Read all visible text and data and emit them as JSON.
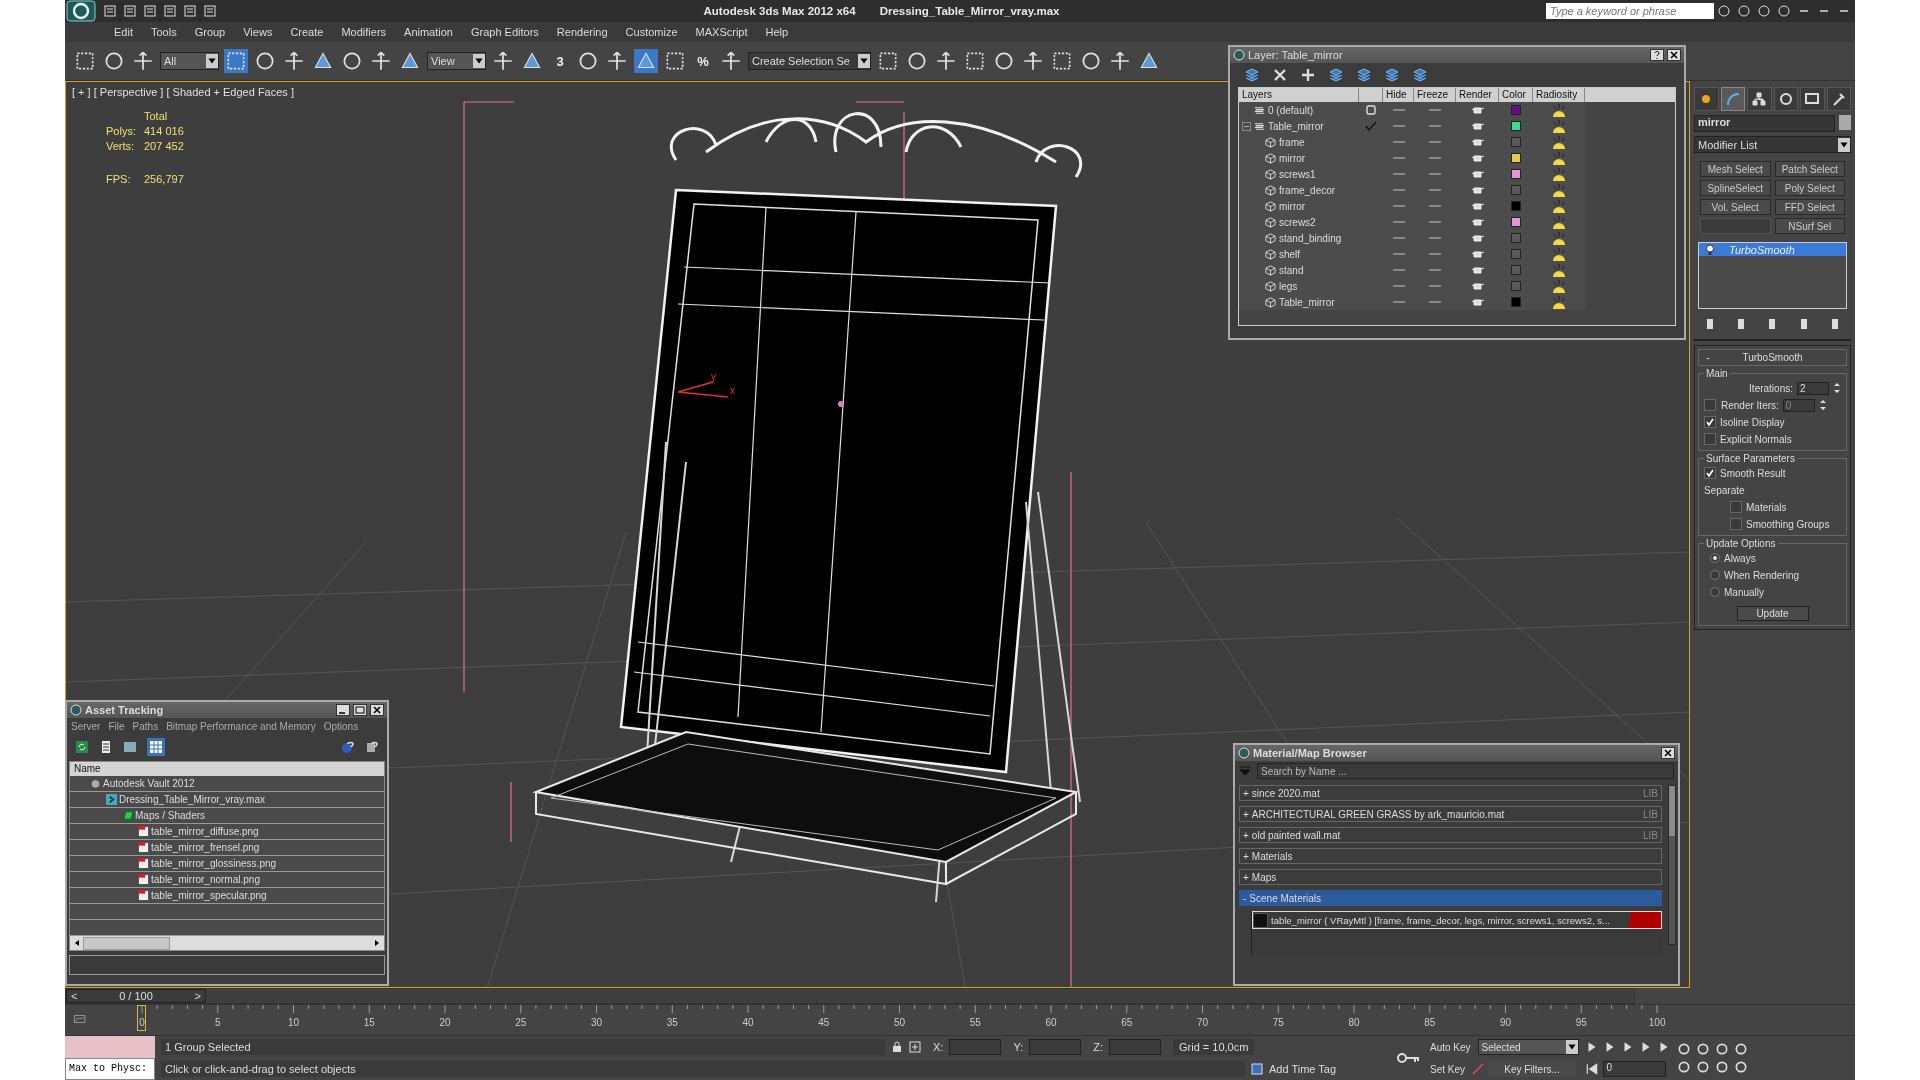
{
  "window": {
    "product": "Autodesk 3ds Max  2012 x64",
    "file": "Dressing_Table_Mirror_vray.max",
    "search_placeholder": "Type a keyword or phrase"
  },
  "menu": [
    "Edit",
    "Tools",
    "Group",
    "Views",
    "Create",
    "Modifiers",
    "Animation",
    "Graph Editors",
    "Rendering",
    "Customize",
    "MAXScript",
    "Help"
  ],
  "toolbar": {
    "selection_filter": "All",
    "reference_coord": "View",
    "named_selection": "Create Selection Se",
    "snap_labels": [
      "3",
      "%"
    ]
  },
  "viewport": {
    "label": "[ + ] [ Perspective ] [ Shaded + Edged Faces ]",
    "stats_title": "Total",
    "stats": [
      {
        "label": "Polys:",
        "value": "414 016"
      },
      {
        "label": "Verts:",
        "value": "207 452"
      }
    ],
    "fps_label": "FPS:",
    "fps": "256,797",
    "axis_labels": [
      "y",
      "x"
    ]
  },
  "layer_window": {
    "title": "Layer: Table_mirror",
    "columns": [
      "Layers",
      "Hide",
      "Freeze",
      "Render",
      "Color",
      "Radiosity"
    ],
    "layers": [
      {
        "name": "0 (default)",
        "current": false,
        "color": "#6a0a8a"
      },
      {
        "name": "Table_mirror",
        "current": true,
        "expanded": true,
        "color": "#40d890",
        "children": [
          {
            "name": "frame",
            "color": "#5a5a5a"
          },
          {
            "name": "mirror",
            "color": "#e8c850"
          },
          {
            "name": "screws1",
            "color": "#e890d8"
          },
          {
            "name": "frame_decor",
            "color": "#5a5a5a"
          },
          {
            "name": "mirror",
            "color": "#000000"
          },
          {
            "name": "screws2",
            "color": "#e890d8"
          },
          {
            "name": "stand_binding",
            "color": "#5a5a5a"
          },
          {
            "name": "shelf",
            "color": "#5a5a5a"
          },
          {
            "name": "stand",
            "color": "#5a5a5a"
          },
          {
            "name": "legs",
            "color": "#5a5a5a"
          },
          {
            "name": "Table_mirror",
            "color": "#000000"
          }
        ]
      }
    ]
  },
  "command_panel": {
    "tabs": [
      {
        "kind": "create",
        "selected": false
      },
      {
        "kind": "modify",
        "selected": true
      },
      {
        "kind": "hierarchy",
        "selected": false
      },
      {
        "kind": "motion",
        "selected": false
      },
      {
        "kind": "display",
        "selected": false
      },
      {
        "kind": "utilities",
        "selected": false
      }
    ],
    "object_name": "mirror",
    "modifier_list": "Modifier List",
    "modifier_buttons": [
      {
        "label": "Mesh Select"
      },
      {
        "label": "Patch Select"
      },
      {
        "label": "SplineSelect"
      },
      {
        "label": "Poly Select"
      },
      {
        "label": "Vol. Select"
      },
      {
        "label": "FFD Select"
      },
      {
        "kind": "blank"
      },
      {
        "label": "NSurf Sel"
      }
    ],
    "stack": [
      {
        "name": "TurboSmooth",
        "selected": true
      }
    ],
    "rollout": {
      "sign": "-",
      "title": "TurboSmooth",
      "main": {
        "title": "Main",
        "iterations_label": "Iterations:",
        "iterations": "2",
        "render_iters": {
          "label": "Render Iters:",
          "checked": false,
          "value": "0"
        },
        "options": [
          {
            "label": "Isoline Display",
            "checked": true
          },
          {
            "label": "Explicit Normals",
            "checked": false
          }
        ]
      },
      "surface": {
        "title": "Surface Parameters",
        "smooth_result": {
          "label": "Smooth Result",
          "checked": true
        },
        "separate_label": "Separate",
        "separate": [
          {
            "label": "Materials",
            "checked": false
          },
          {
            "label": "Smoothing Groups",
            "checked": false
          }
        ]
      },
      "update": {
        "title": "Update Options",
        "options": [
          {
            "label": "Always",
            "selected": true
          },
          {
            "label": "When Rendering",
            "selected": false
          },
          {
            "label": "Manually",
            "selected": false
          }
        ],
        "button": "Update"
      }
    }
  },
  "asset_tracking": {
    "title": "Asset Tracking",
    "menu": [
      "Server",
      "File",
      "Paths",
      "Bitmap Performance and Memory",
      "Options"
    ],
    "column": "Name",
    "tree": [
      {
        "kind": "vault",
        "name": "Autodesk Vault 2012",
        "children": [
          {
            "kind": "max_file",
            "name": "Dressing_Table_Mirror_vray.max",
            "children": [
              {
                "kind": "folder",
                "name": "Maps / Shaders",
                "children": [
                  {
                    "kind": "bitmap",
                    "name": "table_mirror_diffuse.png"
                  },
                  {
                    "kind": "bitmap",
                    "name": "table_mirror_frensel.png"
                  },
                  {
                    "kind": "bitmap",
                    "name": "table_mirror_glossiness.png"
                  },
                  {
                    "kind": "bitmap",
                    "name": "table_mirror_normal.png"
                  },
                  {
                    "kind": "bitmap",
                    "name": "table_mirror_specular.png"
                  }
                ]
              }
            ]
          }
        ]
      }
    ]
  },
  "material_browser": {
    "title": "Material/Map Browser",
    "search_placeholder": "Search by Name ...",
    "groups": [
      {
        "sign": "+",
        "label": "since 2020.mat",
        "tag": "LIB",
        "expanded": false
      },
      {
        "sign": "+",
        "label": "ARCHITECTURAL GREEN GRASS by ark_mauricio.mat",
        "tag": "LIB",
        "expanded": false
      },
      {
        "sign": "+",
        "label": "old painted wall.mat",
        "tag": "LIB",
        "expanded": false
      },
      {
        "sign": "+",
        "label": "Materials",
        "expanded": false
      },
      {
        "sign": "+",
        "label": "Maps",
        "expanded": false
      },
      {
        "sign": "-",
        "label": "Scene Materials",
        "expanded": true,
        "items": [
          {
            "name": "table_mirror  ( VRayMtl )  [frame, frame_decor, legs, mirror, screws1, screws2, s..."
          }
        ]
      }
    ]
  },
  "timeline": {
    "prev": "<",
    "frame": "0 / 100",
    "next": ">",
    "ticks": [
      "0",
      "5",
      "10",
      "15",
      "20",
      "25",
      "30",
      "35",
      "40",
      "45",
      "50",
      "55",
      "60",
      "65",
      "70",
      "75",
      "80",
      "85",
      "90",
      "95",
      "100"
    ]
  },
  "status": {
    "maxscript": "Max to Physc:",
    "selection": "1 Group Selected",
    "prompt": "Click or click-and-drag to select objects",
    "x_label": "X:",
    "y_label": "Y:",
    "z_label": "Z:",
    "grid": "Grid = 10,0cm",
    "add_time_tag": "Add Time Tag",
    "auto_key": "Auto Key",
    "set_key": "Set Key",
    "key_mode": "Selected",
    "key_filters": "Key Filters...",
    "current_frame": "0"
  }
}
